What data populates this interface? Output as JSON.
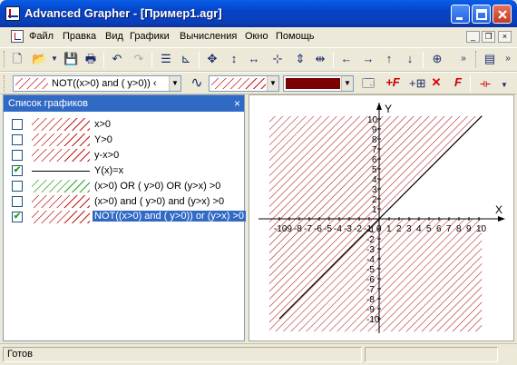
{
  "window": {
    "title": "Advanced Grapher - [Пример1.agr]"
  },
  "menu": {
    "items": [
      "Файл",
      "Правка",
      "Вид",
      "Графики",
      "Вычисления",
      "Окно",
      "Помощь"
    ]
  },
  "toolbar2": {
    "combo_text": "NOT((x>0) and ( y>0)) ‹",
    "color_swatch": "#7B0000"
  },
  "panel": {
    "title": "Список графиков",
    "close_glyph": "×",
    "items": [
      {
        "label": "x>0",
        "checked": false,
        "style": "hatch-red"
      },
      {
        "label": "Y>0",
        "checked": false,
        "style": "hatch-red"
      },
      {
        "label": "y-x>0",
        "checked": false,
        "style": "hatch-red"
      },
      {
        "label": "Y(x)=x",
        "checked": true,
        "style": "solid-black"
      },
      {
        "label": "(x>0) OR ( y>0)  OR  (y>x)  >0",
        "checked": false,
        "style": "hatch-green"
      },
      {
        "label": "(x>0) and ( y>0) and  (y>x)  >0",
        "checked": false,
        "style": "hatch-red"
      },
      {
        "label": "NOT((x>0) and ( y>0))  or  (y>x)  >0",
        "checked": true,
        "style": "hatch-red",
        "selected": true
      }
    ]
  },
  "graph": {
    "x_axis_label": "X",
    "y_axis_label": "Y",
    "x_ticks": [
      "-10",
      "-9",
      "-8",
      "-7",
      "-6",
      "-5",
      "-4",
      "-3",
      "-2",
      "-1",
      "0",
      "1",
      "2",
      "3",
      "4",
      "5",
      "6",
      "7",
      "8",
      "9",
      "10"
    ],
    "y_ticks": [
      "10",
      "9",
      "8",
      "7",
      "6",
      "5",
      "4",
      "3",
      "2",
      "1",
      "-1",
      "-2",
      "-3",
      "-4",
      "-5",
      "-6",
      "-7",
      "-8",
      "-9",
      "-10"
    ],
    "hatch_color": "#B01818",
    "line_color": "#000000"
  },
  "status": {
    "text": "Готов"
  },
  "colors": {
    "titlebar": "#0443C8",
    "selection": "#316AC5",
    "face": "#ECE9D8"
  }
}
